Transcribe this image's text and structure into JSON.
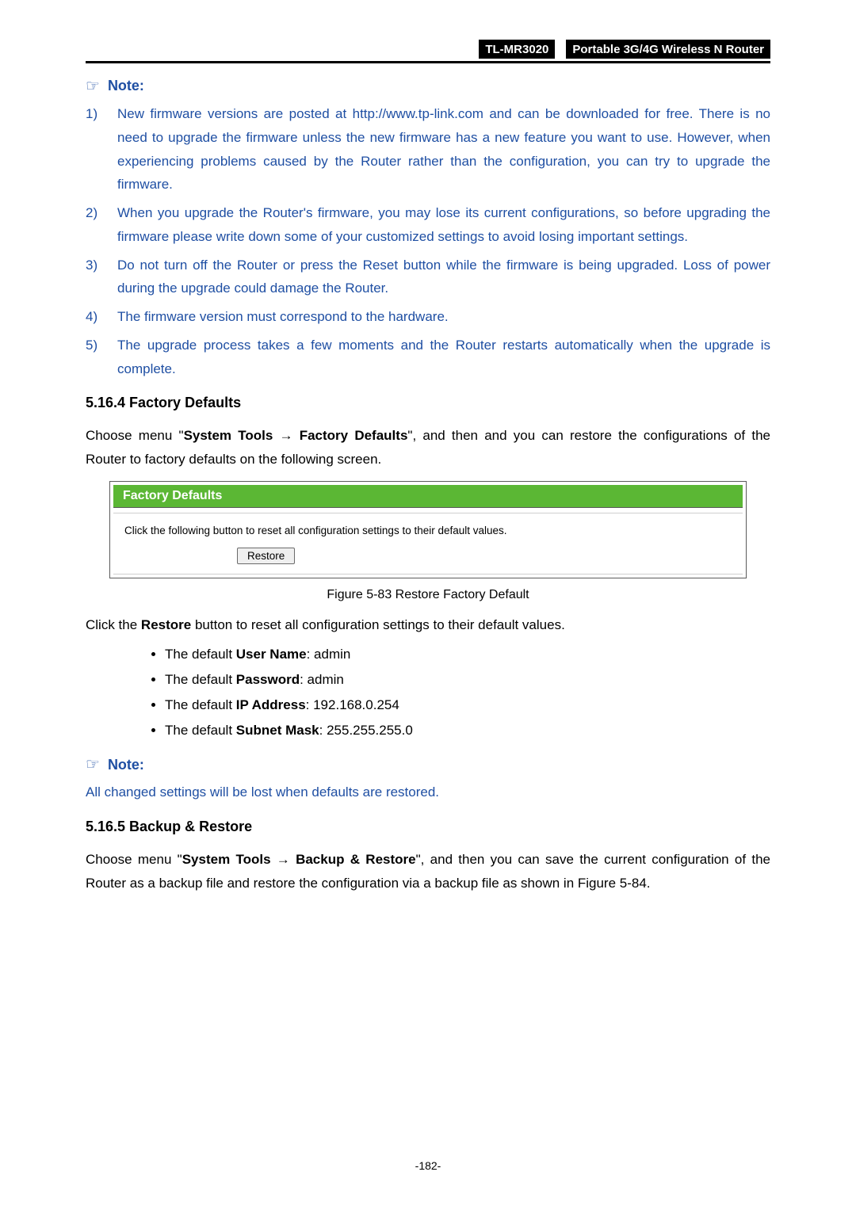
{
  "header": {
    "model": "TL-MR3020",
    "subtitle": "Portable 3G/4G Wireless N Router"
  },
  "note1": {
    "icon_name": "pointing-hand-icon",
    "label": "Note:",
    "items": [
      {
        "num": "1)",
        "text": "New firmware versions are posted at http://www.tp-link.com and can be downloaded for free. There is no need to upgrade the firmware unless the new firmware has a new feature you want to use. However, when experiencing problems caused by the Router rather than the configuration, you can try to upgrade the firmware."
      },
      {
        "num": "2)",
        "text": "When you upgrade the Router's firmware, you may lose its current configurations, so before upgrading the firmware please write down some of your customized settings to avoid losing important settings."
      },
      {
        "num": "3)",
        "text": "Do not turn off the Router or press the Reset button while the firmware is being upgraded. Loss of power during the upgrade could damage the Router."
      },
      {
        "num": "4)",
        "text": "The firmware version must correspond to the hardware."
      },
      {
        "num": "5)",
        "text": "The upgrade process takes a few moments and the Router restarts automatically when the upgrade is complete."
      }
    ]
  },
  "section1": {
    "heading": "5.16.4  Factory Defaults",
    "intro_prefix": "Choose menu \"",
    "intro_bold1": "System Tools",
    "intro_arrow": " → ",
    "intro_bold2": "Factory Defaults",
    "intro_suffix": "\", and then and you can restore the configurations of the Router to factory defaults on the following screen."
  },
  "figure": {
    "title": "Factory Defaults",
    "body": "Click the following button to reset all configuration settings to their default values.",
    "button": "Restore",
    "caption": "Figure 5-83 Restore Factory Default"
  },
  "afterFigure": {
    "prefix": "Click the ",
    "bold": "Restore",
    "suffix": " button to reset all configuration settings to their default values."
  },
  "defaults": [
    {
      "prefix": "The default ",
      "bold": "User Name",
      "suffix": ": admin"
    },
    {
      "prefix": "The default ",
      "bold": "Password",
      "suffix": ": admin"
    },
    {
      "prefix": "The default ",
      "bold": "IP Address",
      "suffix": ": 192.168.0.254"
    },
    {
      "prefix": "The default ",
      "bold": "Subnet Mask",
      "suffix": ": 255.255.255.0"
    }
  ],
  "note2": {
    "label": "Note:",
    "text": "All changed settings will be lost when defaults are restored."
  },
  "section2": {
    "heading": "5.16.5  Backup & Restore",
    "intro_prefix": "Choose menu \"",
    "intro_bold1": "System Tools",
    "intro_arrow": " → ",
    "intro_bold2": "Backup & Restore",
    "intro_suffix": "\", and then you can save the current configuration of the Router as a backup file and restore the configuration via a backup file as shown in Figure 5-84."
  },
  "pageNumber": "-182-"
}
